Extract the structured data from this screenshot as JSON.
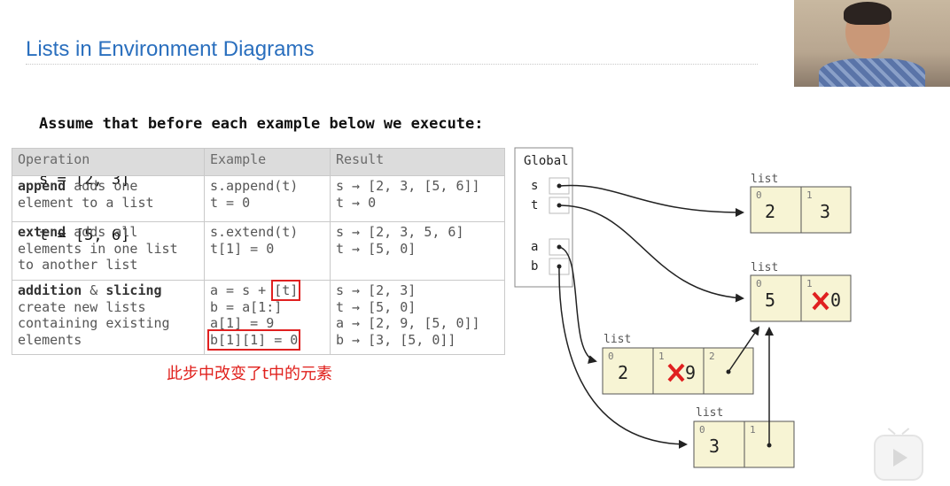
{
  "title": "Lists in Environment Diagrams",
  "preamble": {
    "heading": "Assume that before each example below we execute:",
    "lines": [
      "s = [2, 3]",
      "t = [5, 6]"
    ]
  },
  "table": {
    "headers": [
      "Operation",
      "Example",
      "Result"
    ],
    "rows": [
      {
        "op_name": "append",
        "op_lines": [
          " adds one",
          "element to a list"
        ],
        "example": [
          "s.append(t)",
          "t = 0"
        ],
        "result": [
          "s → [2, 3, [5, 6]]",
          "t → 0"
        ]
      },
      {
        "op_name": "extend",
        "op_lines": [
          " adds all",
          "elements in one list",
          "to another list"
        ],
        "example": [
          "s.extend(t)",
          "t[1] = 0"
        ],
        "result": [
          "s → [2, 3, 5, 6]",
          "t → [5, 0]"
        ]
      },
      {
        "op_name": "addition",
        "op_amp": " & ",
        "op_name2": "slicing",
        "op_lines": [
          "create new lists",
          "containing existing",
          "elements"
        ],
        "example_prefix": "a = s + ",
        "example_hl": "[t]",
        "example": [
          "b = a[1:]",
          "a[1] = 9",
          "b[1][1] = 0"
        ],
        "result": [
          "s → [2, 3]",
          "t → [5, 0]",
          "a → [2, 9, [5, 0]]",
          "b → [3, [5, 0]]"
        ]
      }
    ]
  },
  "note": "此步中改变了t中的元素",
  "frame": {
    "label": "Global",
    "vars": [
      "s",
      "t",
      "a",
      "b"
    ]
  },
  "lists": [
    {
      "label": "list",
      "indices": [
        "0",
        "1"
      ],
      "values": [
        "2",
        "3"
      ]
    },
    {
      "label": "list",
      "indices": [
        "0",
        "1"
      ],
      "values": [
        "5",
        "0"
      ],
      "crossed_index": 1
    },
    {
      "label": "list",
      "indices": [
        "0",
        "1",
        "2"
      ],
      "values": [
        "2",
        "9",
        ""
      ],
      "crossed_index": 1
    },
    {
      "label": "list",
      "indices": [
        "0",
        "1"
      ],
      "values": [
        "3",
        ""
      ]
    }
  ],
  "colors": {
    "title": "#2a6fbe",
    "highlight": "#e02020",
    "cross": "#e02020",
    "list_fill": "#f7f4d4"
  }
}
